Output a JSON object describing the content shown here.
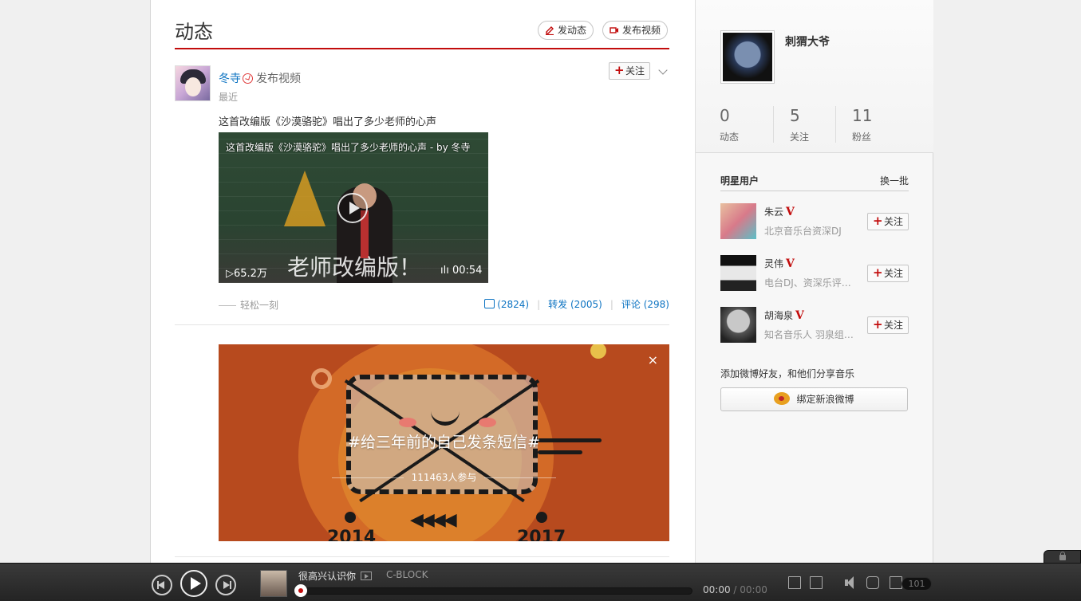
{
  "main": {
    "title": "动态",
    "post_button": "发动态",
    "video_button": "发布视频"
  },
  "post": {
    "user": "冬寺",
    "action": "发布视频",
    "time": "最近",
    "follow": "关注",
    "text": "这首改编版《沙漠骆驼》唱出了多少老师的心声",
    "video": {
      "overlay_title": "这首改编版《沙漠骆驼》唱出了多少老师的心声 - by 冬寺",
      "caption": "老师改编版！",
      "plays": "▷65.2万",
      "duration": "ılı 00:54"
    },
    "source": "轻松一刻",
    "likes": "(2824)",
    "repost": "转发 (2005)",
    "comment": "评论 (298)"
  },
  "banner": {
    "tag": "#给三年前的自己发条短信#",
    "participants": "111463人参与",
    "close": "×",
    "year_start": "2014",
    "year_end": "2017",
    "arrows": "◀◀◀◀"
  },
  "profile": {
    "name": "刺猬大爷",
    "stats": [
      {
        "num": "0",
        "label": "动态"
      },
      {
        "num": "5",
        "label": "关注"
      },
      {
        "num": "11",
        "label": "粉丝"
      }
    ]
  },
  "stars": {
    "title": "明星用户",
    "refresh": "换一批",
    "items": [
      {
        "name": "朱云",
        "v": "V",
        "desc": "北京音乐台资深DJ",
        "follow": "关注"
      },
      {
        "name": "灵伟",
        "v": "V",
        "desc": "电台DJ、资深乐评…",
        "follow": "关注"
      },
      {
        "name": "胡海泉",
        "v": "V",
        "desc": "知名音乐人 羽泉组…",
        "follow": "关注"
      }
    ]
  },
  "weibo": {
    "prompt": "添加微博好友，和他们分享音乐",
    "button": "绑定新浪微博"
  },
  "player": {
    "song": "很高兴认识你",
    "artist": "C-BLOCK",
    "time_current": "00:00",
    "time_sep": " / ",
    "time_total": "00:00",
    "playlist_count": "101",
    "progress": 0
  },
  "colors": {
    "accent": "#c20c0c",
    "link": "#0c73c2",
    "banner_bg": "#b74a1e"
  }
}
